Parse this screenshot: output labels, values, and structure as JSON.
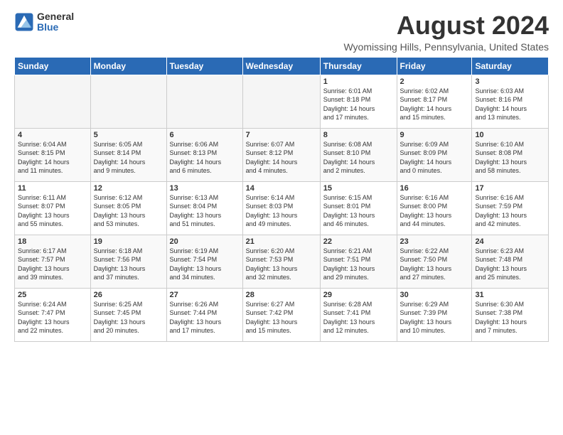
{
  "logo": {
    "general": "General",
    "blue": "Blue"
  },
  "title": "August 2024",
  "location": "Wyomissing Hills, Pennsylvania, United States",
  "weekdays": [
    "Sunday",
    "Monday",
    "Tuesday",
    "Wednesday",
    "Thursday",
    "Friday",
    "Saturday"
  ],
  "weeks": [
    [
      {
        "day": "",
        "info": ""
      },
      {
        "day": "",
        "info": ""
      },
      {
        "day": "",
        "info": ""
      },
      {
        "day": "",
        "info": ""
      },
      {
        "day": "1",
        "info": "Sunrise: 6:01 AM\nSunset: 8:18 PM\nDaylight: 14 hours\nand 17 minutes."
      },
      {
        "day": "2",
        "info": "Sunrise: 6:02 AM\nSunset: 8:17 PM\nDaylight: 14 hours\nand 15 minutes."
      },
      {
        "day": "3",
        "info": "Sunrise: 6:03 AM\nSunset: 8:16 PM\nDaylight: 14 hours\nand 13 minutes."
      }
    ],
    [
      {
        "day": "4",
        "info": "Sunrise: 6:04 AM\nSunset: 8:15 PM\nDaylight: 14 hours\nand 11 minutes."
      },
      {
        "day": "5",
        "info": "Sunrise: 6:05 AM\nSunset: 8:14 PM\nDaylight: 14 hours\nand 9 minutes."
      },
      {
        "day": "6",
        "info": "Sunrise: 6:06 AM\nSunset: 8:13 PM\nDaylight: 14 hours\nand 6 minutes."
      },
      {
        "day": "7",
        "info": "Sunrise: 6:07 AM\nSunset: 8:12 PM\nDaylight: 14 hours\nand 4 minutes."
      },
      {
        "day": "8",
        "info": "Sunrise: 6:08 AM\nSunset: 8:10 PM\nDaylight: 14 hours\nand 2 minutes."
      },
      {
        "day": "9",
        "info": "Sunrise: 6:09 AM\nSunset: 8:09 PM\nDaylight: 14 hours\nand 0 minutes."
      },
      {
        "day": "10",
        "info": "Sunrise: 6:10 AM\nSunset: 8:08 PM\nDaylight: 13 hours\nand 58 minutes."
      }
    ],
    [
      {
        "day": "11",
        "info": "Sunrise: 6:11 AM\nSunset: 8:07 PM\nDaylight: 13 hours\nand 55 minutes."
      },
      {
        "day": "12",
        "info": "Sunrise: 6:12 AM\nSunset: 8:05 PM\nDaylight: 13 hours\nand 53 minutes."
      },
      {
        "day": "13",
        "info": "Sunrise: 6:13 AM\nSunset: 8:04 PM\nDaylight: 13 hours\nand 51 minutes."
      },
      {
        "day": "14",
        "info": "Sunrise: 6:14 AM\nSunset: 8:03 PM\nDaylight: 13 hours\nand 49 minutes."
      },
      {
        "day": "15",
        "info": "Sunrise: 6:15 AM\nSunset: 8:01 PM\nDaylight: 13 hours\nand 46 minutes."
      },
      {
        "day": "16",
        "info": "Sunrise: 6:16 AM\nSunset: 8:00 PM\nDaylight: 13 hours\nand 44 minutes."
      },
      {
        "day": "17",
        "info": "Sunrise: 6:16 AM\nSunset: 7:59 PM\nDaylight: 13 hours\nand 42 minutes."
      }
    ],
    [
      {
        "day": "18",
        "info": "Sunrise: 6:17 AM\nSunset: 7:57 PM\nDaylight: 13 hours\nand 39 minutes."
      },
      {
        "day": "19",
        "info": "Sunrise: 6:18 AM\nSunset: 7:56 PM\nDaylight: 13 hours\nand 37 minutes."
      },
      {
        "day": "20",
        "info": "Sunrise: 6:19 AM\nSunset: 7:54 PM\nDaylight: 13 hours\nand 34 minutes."
      },
      {
        "day": "21",
        "info": "Sunrise: 6:20 AM\nSunset: 7:53 PM\nDaylight: 13 hours\nand 32 minutes."
      },
      {
        "day": "22",
        "info": "Sunrise: 6:21 AM\nSunset: 7:51 PM\nDaylight: 13 hours\nand 29 minutes."
      },
      {
        "day": "23",
        "info": "Sunrise: 6:22 AM\nSunset: 7:50 PM\nDaylight: 13 hours\nand 27 minutes."
      },
      {
        "day": "24",
        "info": "Sunrise: 6:23 AM\nSunset: 7:48 PM\nDaylight: 13 hours\nand 25 minutes."
      }
    ],
    [
      {
        "day": "25",
        "info": "Sunrise: 6:24 AM\nSunset: 7:47 PM\nDaylight: 13 hours\nand 22 minutes."
      },
      {
        "day": "26",
        "info": "Sunrise: 6:25 AM\nSunset: 7:45 PM\nDaylight: 13 hours\nand 20 minutes."
      },
      {
        "day": "27",
        "info": "Sunrise: 6:26 AM\nSunset: 7:44 PM\nDaylight: 13 hours\nand 17 minutes."
      },
      {
        "day": "28",
        "info": "Sunrise: 6:27 AM\nSunset: 7:42 PM\nDaylight: 13 hours\nand 15 minutes."
      },
      {
        "day": "29",
        "info": "Sunrise: 6:28 AM\nSunset: 7:41 PM\nDaylight: 13 hours\nand 12 minutes."
      },
      {
        "day": "30",
        "info": "Sunrise: 6:29 AM\nSunset: 7:39 PM\nDaylight: 13 hours\nand 10 minutes."
      },
      {
        "day": "31",
        "info": "Sunrise: 6:30 AM\nSunset: 7:38 PM\nDaylight: 13 hours\nand 7 minutes."
      }
    ]
  ]
}
